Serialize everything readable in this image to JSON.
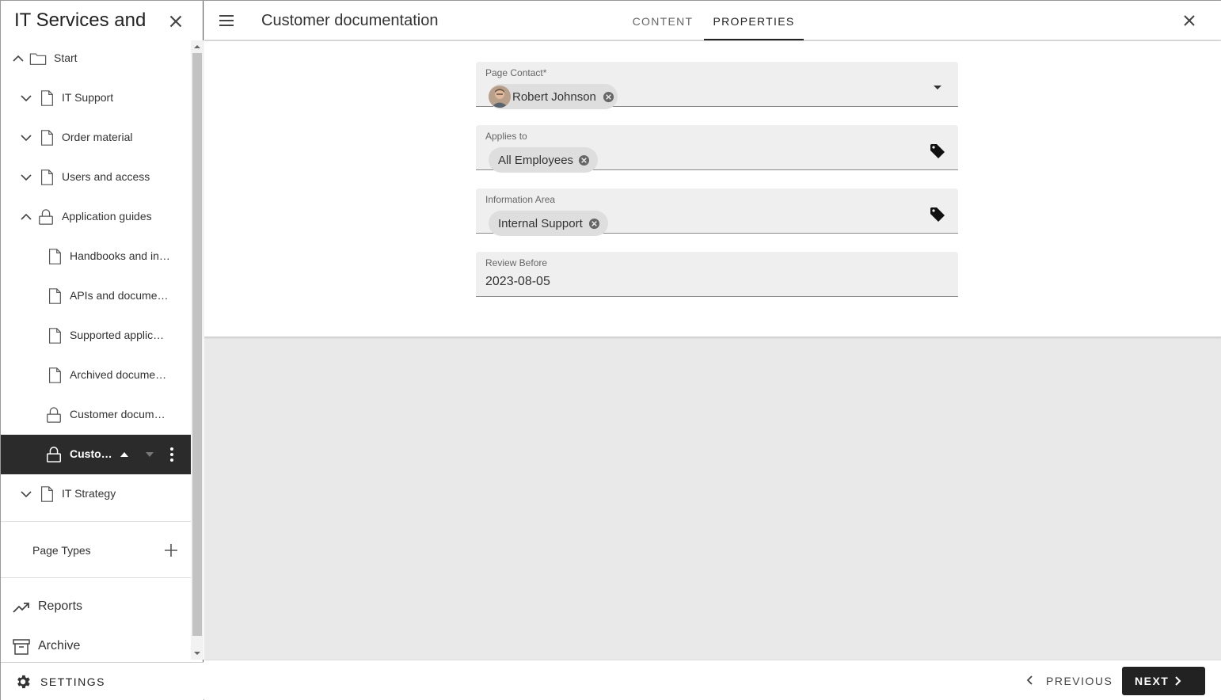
{
  "sidebar": {
    "title": "IT Services and Support",
    "tree": [
      {
        "label": "Start"
      },
      {
        "label": "IT Support"
      },
      {
        "label": "Order material"
      },
      {
        "label": "Users and access"
      },
      {
        "label": "Application guides"
      },
      {
        "label": "Handbooks and in…"
      },
      {
        "label": "APIs and docume…"
      },
      {
        "label": "Supported applic…"
      },
      {
        "label": "Archived docume…"
      },
      {
        "label": "Customer docum…"
      },
      {
        "label": "Custom…"
      },
      {
        "label": "IT Strategy"
      }
    ],
    "page_types_label": "Page Types",
    "reports_label": "Reports",
    "archive_label": "Archive",
    "settings_label": "SETTINGS"
  },
  "header": {
    "page_title": "Customer documentation",
    "tabs": [
      {
        "label": "CONTENT",
        "active": false
      },
      {
        "label": "PROPERTIES",
        "active": true
      }
    ]
  },
  "form": {
    "page_contact": {
      "label": "Page Contact*",
      "value": "Robert Johnson"
    },
    "applies_to": {
      "label": "Applies to",
      "value": "All Employees"
    },
    "information_area": {
      "label": "Information Area",
      "value": "Internal Support"
    },
    "review_before": {
      "label": "Review Before",
      "value": "2023-08-05"
    }
  },
  "footer": {
    "previous_label": "PREVIOUS",
    "next_label": "NEXT"
  },
  "icons": {
    "close": "close-icon",
    "menu": "menu-icon",
    "folder": "folder-icon",
    "page": "page-icon",
    "lock": "lock-icon",
    "tag": "tag-icon",
    "settings": "gear-icon"
  },
  "colors": {
    "selected_row": "#2b2b2b",
    "primary_button": "#222222",
    "field_bg": "#efefef",
    "main_bg": "#e9e9e9"
  }
}
